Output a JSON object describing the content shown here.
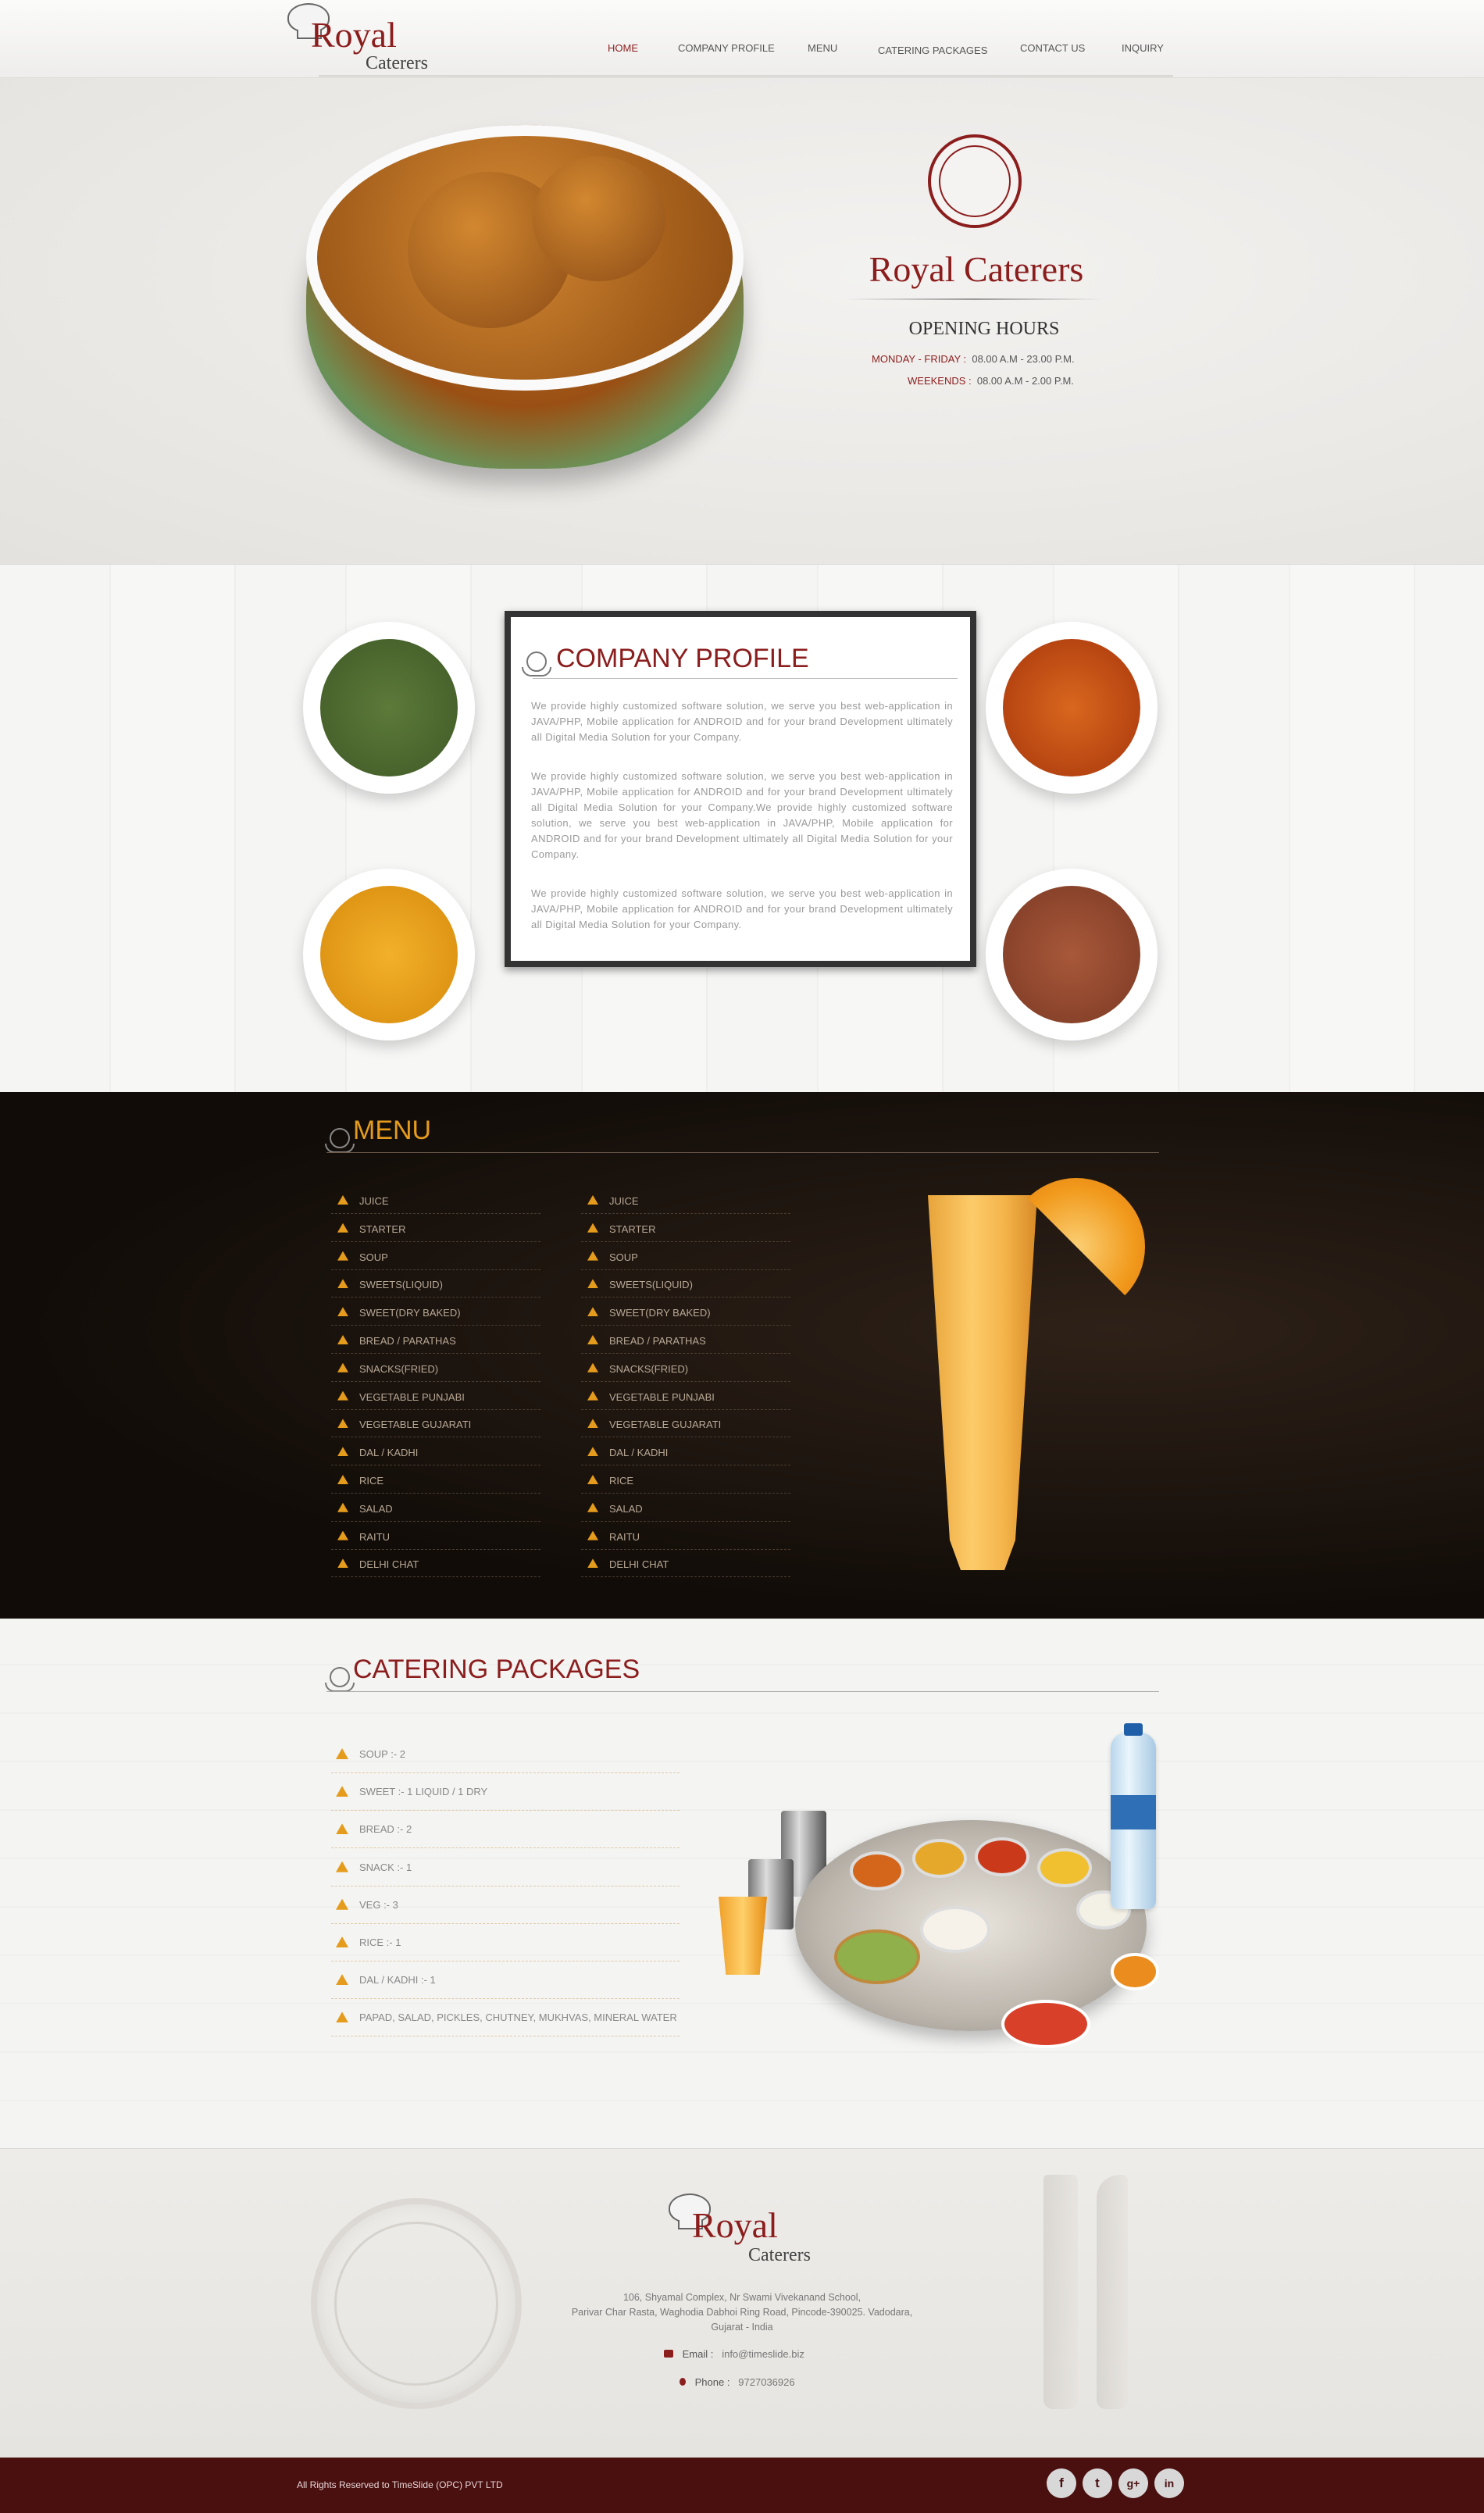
{
  "brand": {
    "royal": "Royal",
    "caterers": "Caterers"
  },
  "nav": {
    "items": [
      "HOME",
      "COMPANY PROFILE",
      "MENU",
      "CATERING PACKAGES",
      "CONTACT US",
      "INQUIRY"
    ]
  },
  "hero": {
    "title": "Royal Caterers",
    "hours_title": "OPENING HOURS",
    "weekday_label": "MONDAY - FRIDAY :",
    "weekday_value": "08.00 A.M - 23.00 P.M.",
    "weekend_label": "WEEKENDS :",
    "weekend_value": "08.00 A.M - 2.00 P.M."
  },
  "profile": {
    "title": "COMPANY PROFILE",
    "p1": "We provide highly customized software solution, we serve you best web-application in JAVA/PHP, Mobile application for ANDROID and for your brand Development ultimately all Digital Media Solution for your Company.",
    "p2": "We provide highly customized software solution, we serve you best web-application in JAVA/PHP, Mobile application for ANDROID and for your brand Development ultimately all Digital Media Solution for your Company.We provide highly customized software solution, we serve you best web-application in JAVA/PHP, Mobile application for ANDROID and for your brand Development ultimately all Digital Media Solution for your Company.",
    "p3": "We provide highly customized software solution, we serve you best web-application in JAVA/PHP, Mobile application for ANDROID and for your brand Development ultimately all Digital Media Solution for your Company."
  },
  "menu": {
    "title": "MENU",
    "col1": [
      "JUICE",
      "STARTER",
      "SOUP",
      "SWEETS(LIQUID)",
      "SWEET(DRY BAKED)",
      "BREAD / PARATHAS",
      "SNACKS(FRIED)",
      "VEGETABLE PUNJABI",
      "VEGETABLE GUJARATI",
      "DAL / KADHI",
      "RICE",
      "SALAD",
      "RAITU",
      "DELHI CHAT"
    ],
    "col2": [
      "JUICE",
      "STARTER",
      "SOUP",
      "SWEETS(LIQUID)",
      "SWEET(DRY BAKED)",
      "BREAD / PARATHAS",
      "SNACKS(FRIED)",
      "VEGETABLE PUNJABI",
      "VEGETABLE GUJARATI",
      "DAL / KADHI",
      "RICE",
      "SALAD",
      "RAITU",
      "DELHI CHAT"
    ]
  },
  "catering": {
    "title": "CATERING PACKAGES",
    "items": [
      "SOUP :- 2",
      "SWEET :- 1 LIQUID / 1 DRY",
      "BREAD :- 2",
      "SNACK :- 1",
      "VEG :- 3",
      "RICE :- 1",
      "DAL / KADHI :- 1",
      "PAPAD, SALAD, PICKLES, CHUTNEY, MUKHVAS, MINERAL WATER"
    ]
  },
  "footer": {
    "address1": "106, Shyamal Complex, Nr Swami Vivekanand School,",
    "address2": "Parivar Char Rasta, Waghodia Dabhoi Ring Road, Pincode-390025. Vadodara,",
    "address3": "Gujarat - India",
    "email_label": "Email :",
    "email_value": "info@timeslide.biz",
    "phone_label": "Phone :",
    "phone_value": "9727036926",
    "copyright": "All Rights Reserved to TimeSlide (OPC) PVT LTD"
  },
  "social": [
    {
      "icon": "facebook-icon",
      "glyph": "f"
    },
    {
      "icon": "twitter-icon",
      "glyph": "t"
    },
    {
      "icon": "google-plus-icon",
      "glyph": "g+"
    },
    {
      "icon": "linkedin-icon",
      "glyph": "in"
    }
  ],
  "colors": {
    "brand": "#8b1d1d",
    "accent": "#e59b1c",
    "footer_bar": "#4a0f0f"
  }
}
